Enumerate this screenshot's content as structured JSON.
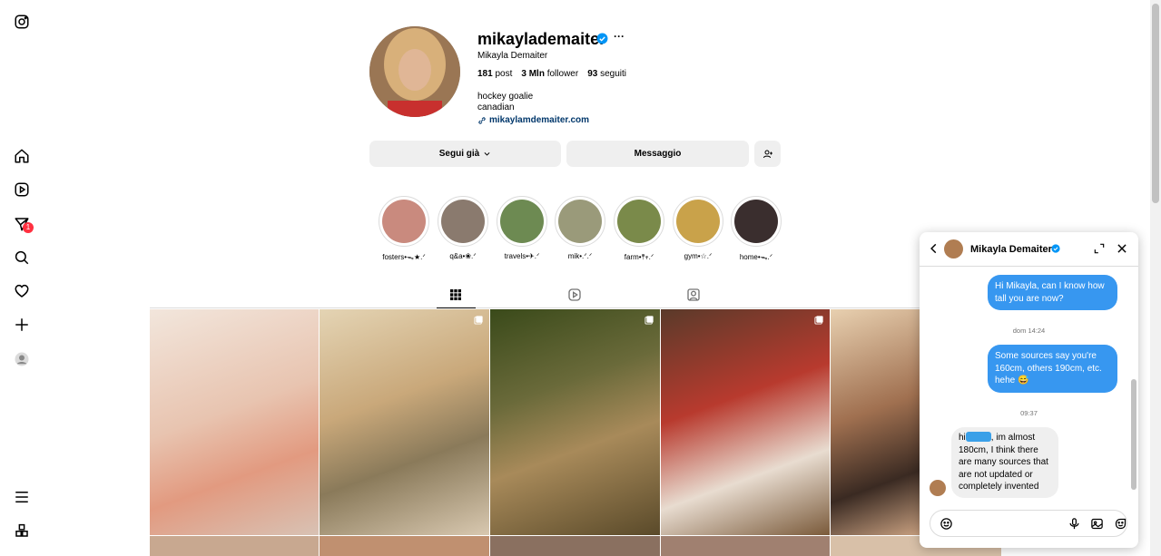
{
  "nav": {
    "items": [
      "instagram-logo",
      "home-icon",
      "reels-icon",
      "messages-icon",
      "search-icon",
      "notifications-icon",
      "create-icon",
      "profile-icon",
      "menu-icon",
      "more-icon"
    ],
    "messages_badge": "1"
  },
  "profile": {
    "username": "mikaylademaiter",
    "full_name": "Mikayla Demaiter",
    "stats": {
      "posts_count": "181",
      "posts_label": "post",
      "followers_count": "3 Mln",
      "followers_label": "follower",
      "following_count": "93",
      "following_label": "seguiti"
    },
    "bio_line1": "hockey goalie",
    "bio_line2": "canadian",
    "link": "mikaylamdemaiter.com",
    "follow_button": "Segui già",
    "message_button": "Messaggio"
  },
  "highlights": [
    {
      "label": "fosters•ᯓ★.ᐟ",
      "color": "#c98a7e"
    },
    {
      "label": "q&a•❀.ᐟ",
      "color": "#8a7a6e"
    },
    {
      "label": "travels•✈.ᐟ",
      "color": "#6d8a52"
    },
    {
      "label": "mik•.ᐟ.ᐟ",
      "color": "#9a9a7a"
    },
    {
      "label": "farm•𖤣𖥧.ᐟ",
      "color": "#7a8a4a"
    },
    {
      "label": "gym•☆.ᐟ",
      "color": "#c9a24a"
    },
    {
      "label": "home•ᯓ.ᐟ",
      "color": "#3a2e2e"
    }
  ],
  "tabs": [
    "posts-tab",
    "reels-tab",
    "tagged-tab"
  ],
  "posts": [
    {
      "color": "#e8b8a2"
    },
    {
      "color": "#c8b088"
    },
    {
      "color": "#6a6a3a"
    },
    {
      "color": "#a8503a"
    },
    {
      "color": "#a07050"
    }
  ],
  "chat": {
    "name": "Mikayla Demaiter",
    "messages": [
      {
        "type": "out",
        "text": "Hi Mikayla, can I know how tall you are now?"
      },
      {
        "type": "time",
        "text": "dom 14:24"
      },
      {
        "type": "out",
        "text": "Some sources say you're 160cm, others 190cm, etc. hehe 😅"
      },
      {
        "type": "time",
        "text": "09:37"
      },
      {
        "type": "in",
        "text_before": "hi",
        "text_after": ", im almost 180cm, I think there are many sources that are not updated or completely invented"
      }
    ]
  },
  "colors": {
    "accent_blue": "#3797f0",
    "verified_blue": "#0095f6",
    "button_bg": "#efefef",
    "badge_red": "#ff3040"
  }
}
